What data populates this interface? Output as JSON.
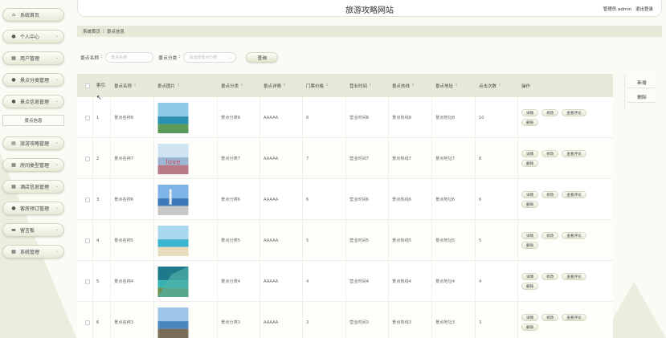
{
  "header": {
    "title": "旅游攻略网站",
    "role_label": "管理员 admin",
    "logout_label": "退出登录"
  },
  "sidebar": {
    "items": [
      {
        "label": "系统首页",
        "icon": "home-icon",
        "glyph": "⌂",
        "chevron": false
      },
      {
        "label": "个人中心",
        "icon": "user-icon",
        "glyph": "●",
        "chevron": true
      },
      {
        "label": "用户管理",
        "icon": "grid-icon",
        "glyph": "▦",
        "chevron": true
      },
      {
        "label": "景点分类管理",
        "icon": "user-icon",
        "glyph": "●",
        "chevron": true
      },
      {
        "label": "景点信息管理",
        "icon": "user-icon",
        "glyph": "●",
        "chevron": true
      },
      {
        "label": "旅游攻略管理",
        "icon": "list-icon",
        "glyph": "▤",
        "chevron": true
      },
      {
        "label": "房间类型管理",
        "icon": "grid-icon",
        "glyph": "▦",
        "chevron": true
      },
      {
        "label": "酒店信息管理",
        "icon": "grid-icon",
        "glyph": "▦",
        "chevron": true
      },
      {
        "label": "客房预订管理",
        "icon": "user-icon",
        "glyph": "●",
        "chevron": true
      },
      {
        "label": "留言板",
        "icon": "message-icon",
        "glyph": "▬",
        "chevron": true
      },
      {
        "label": "系统管理",
        "icon": "grid-icon",
        "glyph": "▦",
        "chevron": true
      }
    ],
    "sub_item": "景点信息"
  },
  "breadcrumb": {
    "home": "系统首页",
    "separator": "|",
    "current": "景点信息"
  },
  "search": {
    "name_label": "景点名称",
    "name_placeholder": "景点名称",
    "category_label": "景点分类",
    "category_placeholder": "请选择景点分类",
    "query_button": "查询"
  },
  "actions": {
    "add": "新增",
    "delete": "删除"
  },
  "table": {
    "headers": {
      "index": "索引",
      "name": "景点名称",
      "image": "景点图片",
      "category": "景点分类",
      "detail": "景点详情",
      "price": "门票价格",
      "hours": "营业时间",
      "hotline": "景点热线",
      "address": "景点地址",
      "clicks": "点击次数",
      "ops": "操作"
    },
    "op_labels": {
      "detail": "详情",
      "edit": "修改",
      "comments": "查看评论",
      "delete": "删除"
    },
    "rows": [
      {
        "index": "1",
        "name": "景点名称8",
        "category": "景点分类8",
        "detail": "AAAAA",
        "price": "8",
        "hours": "营业时间8",
        "hotline": "景点热线8",
        "address": "景点地址8",
        "clicks": "10",
        "image": "beach-island"
      },
      {
        "index": "2",
        "name": "景点名称7",
        "category": "景点分类7",
        "detail": "AAAAA",
        "price": "7",
        "hours": "营业时间7",
        "hotline": "景点热线7",
        "address": "景点地址7",
        "clicks": "8",
        "image": "love-letters"
      },
      {
        "index": "3",
        "name": "景点名称6",
        "category": "景点分类6",
        "detail": "AAAAA",
        "price": "6",
        "hours": "营业时间6",
        "hotline": "景点热线6",
        "address": "景点地址6",
        "clicks": "6",
        "image": "lighthouse"
      },
      {
        "index": "4",
        "name": "景点名称5",
        "category": "景点分类5",
        "detail": "AAAAA",
        "price": "5",
        "hours": "营业时间5",
        "hotline": "景点热线5",
        "address": "景点地址5",
        "clicks": "5",
        "image": "sandy-beach"
      },
      {
        "index": "5",
        "name": "景点名称4",
        "category": "景点分类4",
        "detail": "AAAAA",
        "price": "4",
        "hours": "营业时间4",
        "hotline": "景点热线4",
        "address": "景点地址4",
        "clicks": "4",
        "image": "coastline"
      },
      {
        "index": "6",
        "name": "景点名称3",
        "category": "景点分类3",
        "detail": "AAAAA",
        "price": "3",
        "hours": "营业时间3",
        "hotline": "景点热线3",
        "address": "景点地址3",
        "clicks": "3",
        "image": "resort-bay"
      }
    ]
  }
}
